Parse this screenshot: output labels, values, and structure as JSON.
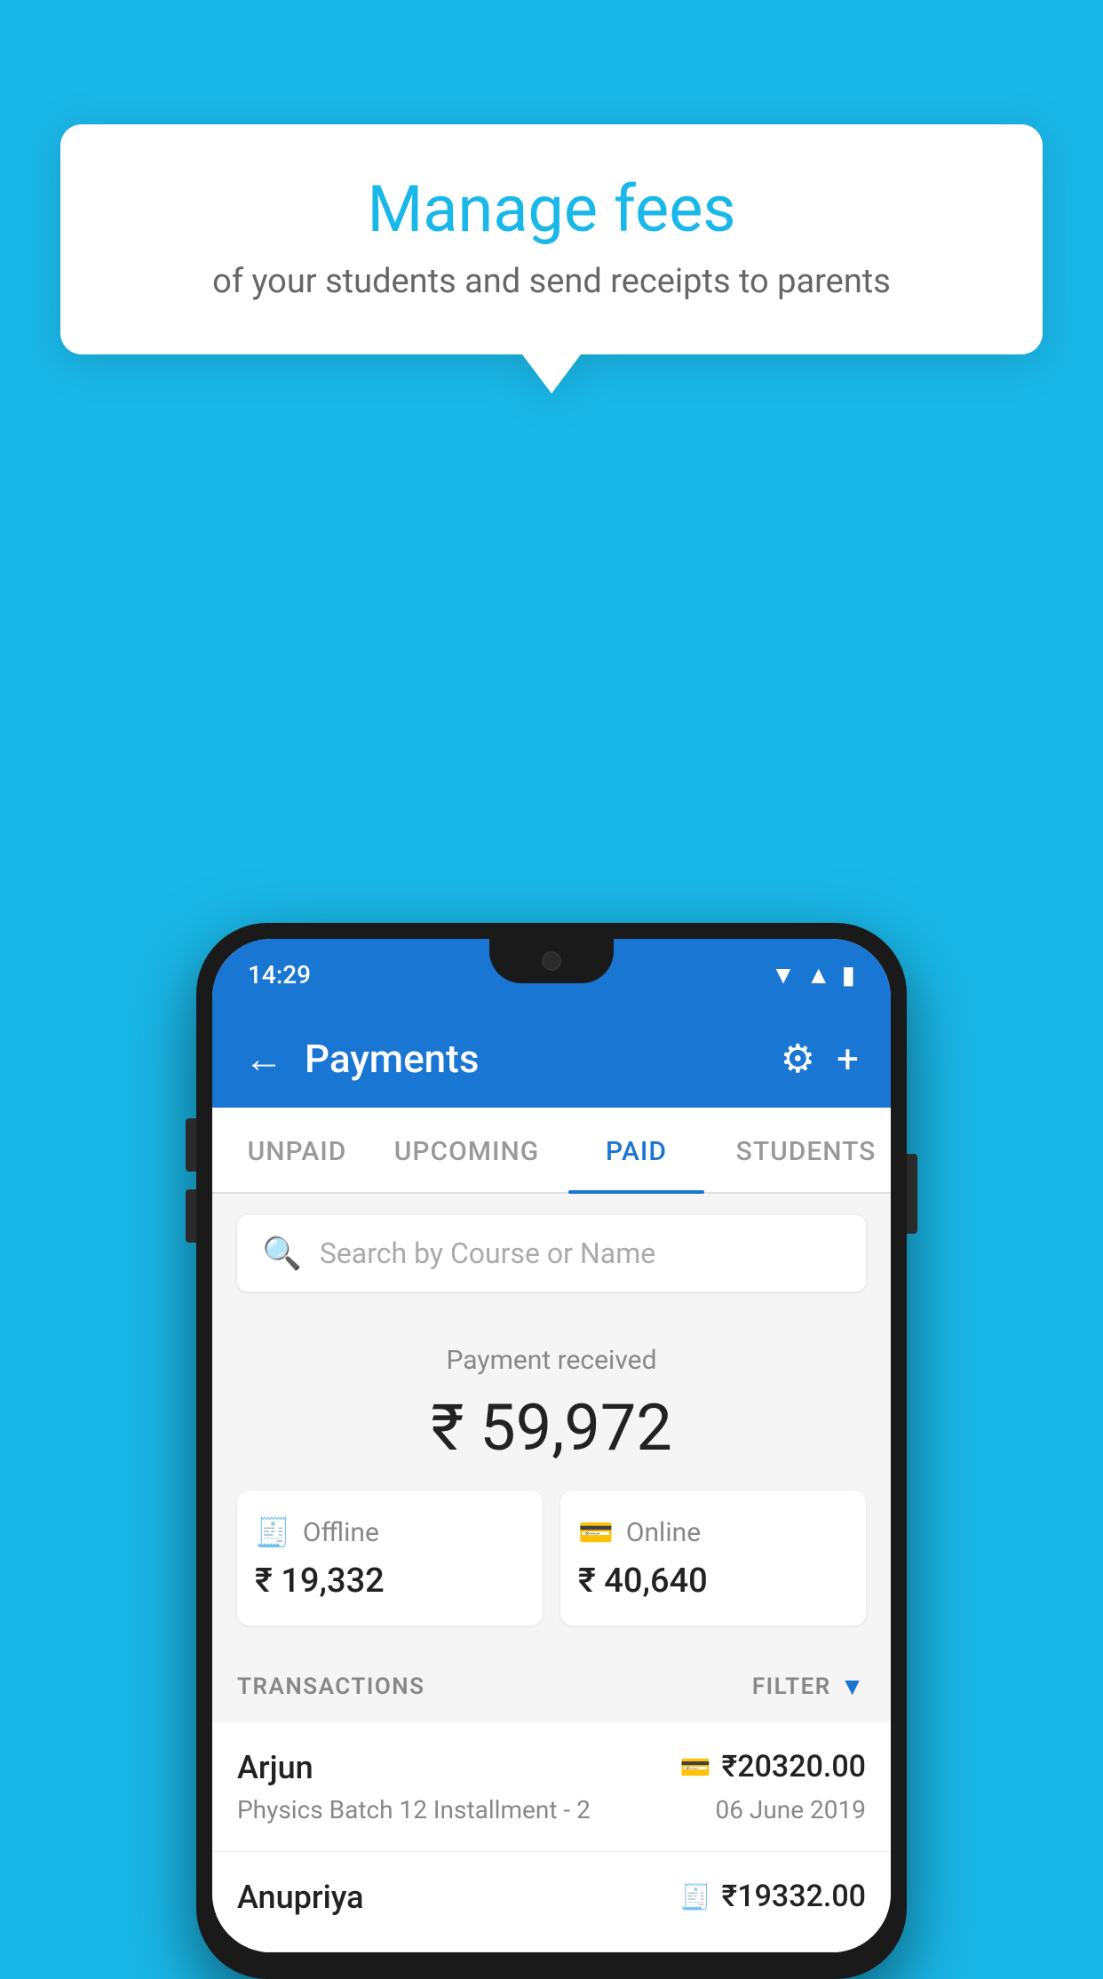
{
  "background_color": "#1ab8e8",
  "tooltip": {
    "title": "Manage fees",
    "subtitle": "of your students and send receipts to parents"
  },
  "status_bar": {
    "time": "14:29",
    "icons": [
      "wifi",
      "signal",
      "battery"
    ]
  },
  "header": {
    "title": "Payments",
    "back_label": "←",
    "settings_icon": "⚙",
    "add_icon": "+"
  },
  "tabs": [
    {
      "label": "UNPAID",
      "active": false
    },
    {
      "label": "UPCOMING",
      "active": false
    },
    {
      "label": "PAID",
      "active": true
    },
    {
      "label": "STUDENTS",
      "active": false
    }
  ],
  "search": {
    "placeholder": "Search by Course or Name"
  },
  "payment_received": {
    "label": "Payment received",
    "total": "₹ 59,972",
    "offline": {
      "type": "Offline",
      "amount": "₹ 19,332"
    },
    "online": {
      "type": "Online",
      "amount": "₹ 40,640"
    }
  },
  "transactions": {
    "header_label": "TRANSACTIONS",
    "filter_label": "FILTER",
    "rows": [
      {
        "name": "Arjun",
        "course": "Physics Batch 12 Installment - 2",
        "amount": "₹20320.00",
        "date": "06 June 2019",
        "payment_icon": "card"
      },
      {
        "name": "Anupriya",
        "course": "",
        "amount": "₹19332.00",
        "date": "",
        "payment_icon": "cash"
      }
    ]
  }
}
